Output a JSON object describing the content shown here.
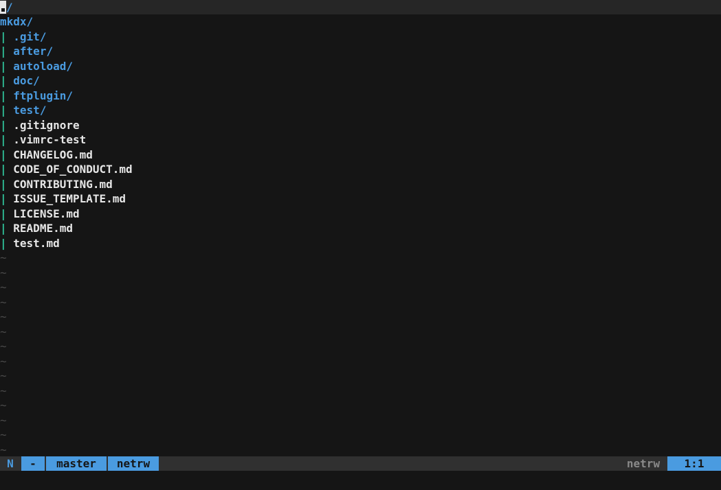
{
  "header": {
    "cursor_glyph": ".",
    "cwd_rest": "/"
  },
  "listing": {
    "root": "mkdx/",
    "guide": "|",
    "entries": [
      {
        "name": ".git/",
        "type": "dir"
      },
      {
        "name": "after/",
        "type": "dir"
      },
      {
        "name": "autoload/",
        "type": "dir"
      },
      {
        "name": "doc/",
        "type": "dir"
      },
      {
        "name": "ftplugin/",
        "type": "dir"
      },
      {
        "name": "test/",
        "type": "dir"
      },
      {
        "name": ".gitignore",
        "type": "file"
      },
      {
        "name": ".vimrc-test",
        "type": "file"
      },
      {
        "name": "CHANGELOG.md",
        "type": "file"
      },
      {
        "name": "CODE_OF_CONDUCT.md",
        "type": "file"
      },
      {
        "name": "CONTRIBUTING.md",
        "type": "file"
      },
      {
        "name": "ISSUE_TEMPLATE.md",
        "type": "file"
      },
      {
        "name": "LICENSE.md",
        "type": "file"
      },
      {
        "name": "README.md",
        "type": "file"
      },
      {
        "name": "test.md",
        "type": "file"
      }
    ],
    "tilde": "~",
    "tilde_rows": 14
  },
  "statusline": {
    "mode": "N",
    "modified": "-",
    "branch": "master",
    "filetype_left": "netrw",
    "filetype_right": "netrw",
    "position": "1:1"
  },
  "colors": {
    "background": "#151515",
    "directory": "#4a9be0",
    "file": "#e6e6e6",
    "indent_guide": "#2fc29a",
    "statusline_accent": "#4a9be0"
  }
}
